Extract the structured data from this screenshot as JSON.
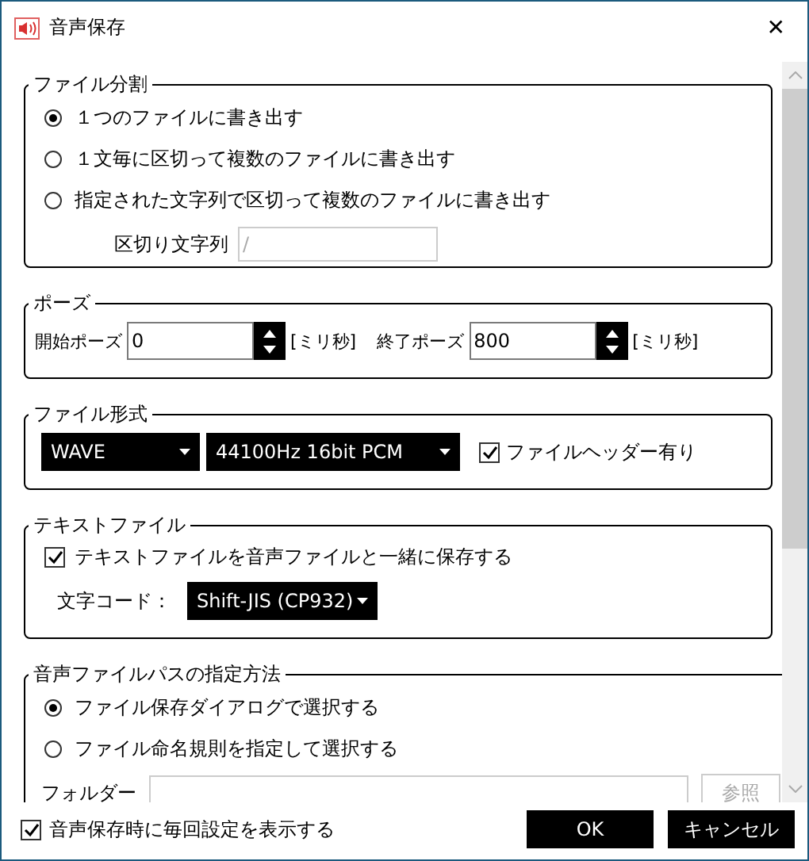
{
  "window": {
    "title": "音声保存",
    "close": "✕"
  },
  "file_split": {
    "title": "ファイル分割",
    "options": [
      {
        "label": "１つのファイルに書き出す",
        "selected": true
      },
      {
        "label": "１文毎に区切って複数のファイルに書き出す",
        "selected": false
      },
      {
        "label": "指定された文字列で区切って複数のファイルに書き出す",
        "selected": false
      }
    ],
    "delimiter": {
      "label": "区切り文字列",
      "value": "/",
      "disabled": true
    }
  },
  "pause": {
    "title": "ポーズ",
    "fields": [
      {
        "label": "開始ポーズ",
        "value": "0",
        "unit": "[ミリ秒]"
      },
      {
        "label": "終了ポーズ",
        "value": "800",
        "unit": "[ミリ秒]"
      }
    ]
  },
  "file_format": {
    "title": "ファイル形式",
    "format": "WAVE",
    "quality": "44100Hz 16bit PCM",
    "header": {
      "label": "ファイルヘッダー有り",
      "checked": true
    }
  },
  "text_file": {
    "title": "テキストファイル",
    "save": {
      "label": "テキストファイルを音声ファイルと一緒に保存する",
      "checked": true
    },
    "encoding": {
      "label": "文字コード：",
      "value": "Shift-JIS (CP932)"
    }
  },
  "path_method": {
    "title": "音声ファイルパスの指定方法",
    "options": [
      {
        "label": "ファイル保存ダイアログで選択する",
        "selected": true
      },
      {
        "label": "ファイル命名規則を指定して選択する",
        "selected": false
      }
    ],
    "folder": {
      "label": "フォルダー"
    },
    "browse": "参照"
  },
  "footer": {
    "show_every_time": {
      "label": "音声保存時に毎回設定を表示する",
      "checked": true
    },
    "buttons": [
      "OK",
      "キャンセル"
    ]
  }
}
